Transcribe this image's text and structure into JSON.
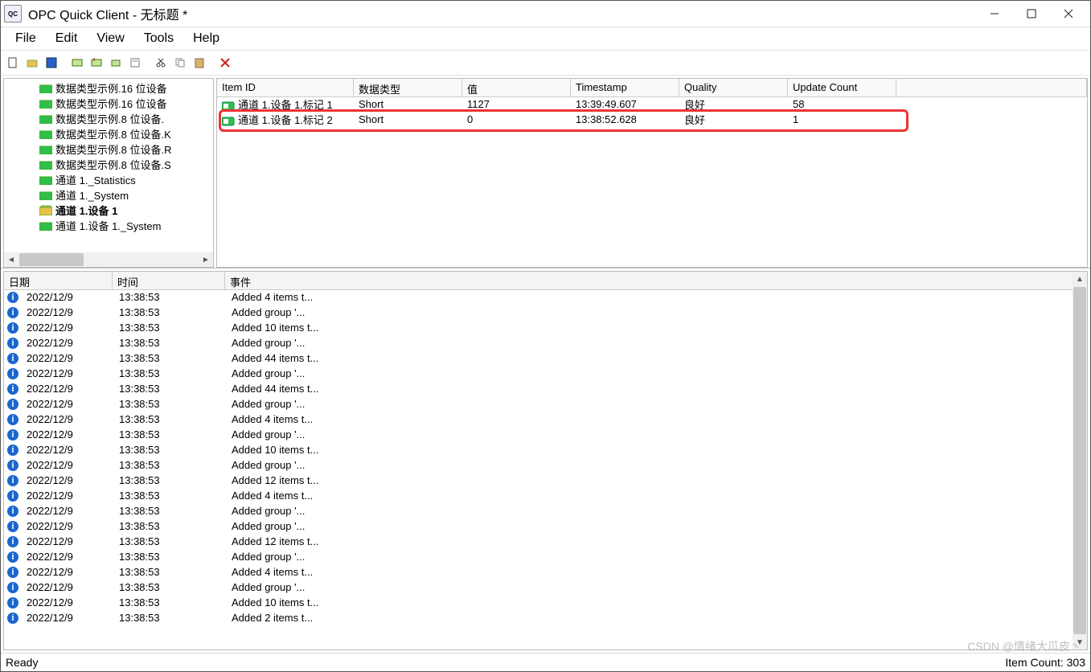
{
  "window": {
    "title": "OPC Quick Client - 无标题 *"
  },
  "menu": {
    "file": "File",
    "edit": "Edit",
    "view": "View",
    "tools": "Tools",
    "help": "Help"
  },
  "tree": {
    "items": [
      {
        "label": "数据类型示例.16 位设备",
        "selected": false
      },
      {
        "label": "数据类型示例.16 位设备",
        "selected": false
      },
      {
        "label": "数据类型示例.8 位设备.",
        "selected": false
      },
      {
        "label": "数据类型示例.8 位设备.K",
        "selected": false
      },
      {
        "label": "数据类型示例.8 位设备.R",
        "selected": false
      },
      {
        "label": "数据类型示例.8 位设备.S",
        "selected": false
      },
      {
        "label": "通道 1._Statistics",
        "selected": false
      },
      {
        "label": "通道 1._System",
        "selected": false
      },
      {
        "label": "通道 1.设备 1",
        "selected": true
      },
      {
        "label": "通道 1.设备 1._System",
        "selected": false
      }
    ]
  },
  "tag_headers": {
    "id": "Item ID",
    "type": "数据类型",
    "value": "值",
    "timestamp": "Timestamp",
    "quality": "Quality",
    "update_count": "Update Count"
  },
  "tags": [
    {
      "id": "通道 1.设备 1.标记 1",
      "type": "Short",
      "value": "1127",
      "timestamp": "13:39:49.607",
      "quality": "良好",
      "update_count": "58",
      "highlighted": false
    },
    {
      "id": "通道 1.设备 1.标记 2",
      "type": "Short",
      "value": "0",
      "timestamp": "13:38:52.628",
      "quality": "良好",
      "update_count": "1",
      "highlighted": true
    }
  ],
  "log_headers": {
    "date": "日期",
    "time": "时间",
    "event": "事件"
  },
  "log": [
    {
      "date": "2022/12/9",
      "time": "13:38:53",
      "event": "Added 4 items t..."
    },
    {
      "date": "2022/12/9",
      "time": "13:38:53",
      "event": "Added group '..."
    },
    {
      "date": "2022/12/9",
      "time": "13:38:53",
      "event": "Added 10 items t..."
    },
    {
      "date": "2022/12/9",
      "time": "13:38:53",
      "event": "Added group '..."
    },
    {
      "date": "2022/12/9",
      "time": "13:38:53",
      "event": "Added 44 items t..."
    },
    {
      "date": "2022/12/9",
      "time": "13:38:53",
      "event": "Added group '..."
    },
    {
      "date": "2022/12/9",
      "time": "13:38:53",
      "event": "Added 44 items t..."
    },
    {
      "date": "2022/12/9",
      "time": "13:38:53",
      "event": "Added group '..."
    },
    {
      "date": "2022/12/9",
      "time": "13:38:53",
      "event": "Added 4 items t..."
    },
    {
      "date": "2022/12/9",
      "time": "13:38:53",
      "event": "Added group '..."
    },
    {
      "date": "2022/12/9",
      "time": "13:38:53",
      "event": "Added 10 items t..."
    },
    {
      "date": "2022/12/9",
      "time": "13:38:53",
      "event": "Added group '..."
    },
    {
      "date": "2022/12/9",
      "time": "13:38:53",
      "event": "Added 12 items t..."
    },
    {
      "date": "2022/12/9",
      "time": "13:38:53",
      "event": "Added 4 items t..."
    },
    {
      "date": "2022/12/9",
      "time": "13:38:53",
      "event": "Added group '..."
    },
    {
      "date": "2022/12/9",
      "time": "13:38:53",
      "event": "Added group '..."
    },
    {
      "date": "2022/12/9",
      "time": "13:38:53",
      "event": "Added 12 items t..."
    },
    {
      "date": "2022/12/9",
      "time": "13:38:53",
      "event": "Added group '..."
    },
    {
      "date": "2022/12/9",
      "time": "13:38:53",
      "event": "Added 4 items t..."
    },
    {
      "date": "2022/12/9",
      "time": "13:38:53",
      "event": "Added group '..."
    },
    {
      "date": "2022/12/9",
      "time": "13:38:53",
      "event": "Added 10 items t..."
    },
    {
      "date": "2022/12/9",
      "time": "13:38:53",
      "event": "Added 2 items t..."
    }
  ],
  "status": {
    "ready": "Ready",
    "item_count": "Item Count: 303"
  },
  "watermark": "CSDN @情绪大瓜皮丶"
}
